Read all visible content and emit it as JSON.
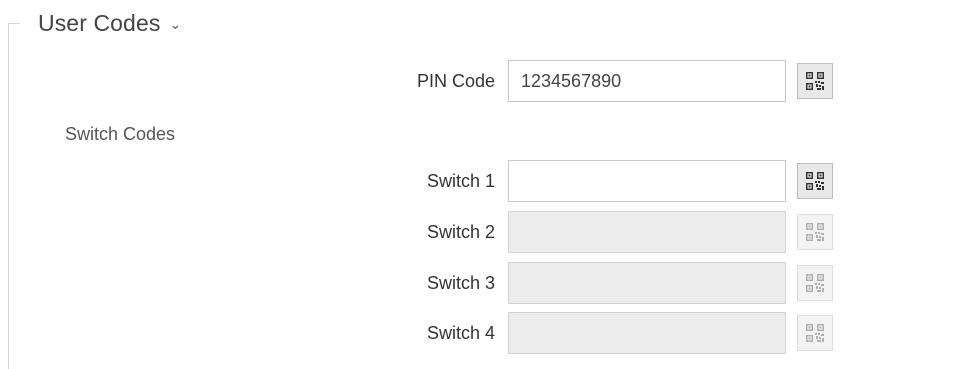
{
  "section": {
    "title": "User Codes",
    "chevron_icon": "chevron-down-icon"
  },
  "pin": {
    "label": "PIN Code",
    "value": "1234567890",
    "qr_icon": "qr-code-icon"
  },
  "switch_codes": {
    "heading": "Switch Codes",
    "items": [
      {
        "label": "Switch 1",
        "value": "",
        "enabled": true
      },
      {
        "label": "Switch 2",
        "value": "",
        "enabled": false
      },
      {
        "label": "Switch 3",
        "value": "",
        "enabled": false
      },
      {
        "label": "Switch 4",
        "value": "",
        "enabled": false
      }
    ]
  }
}
